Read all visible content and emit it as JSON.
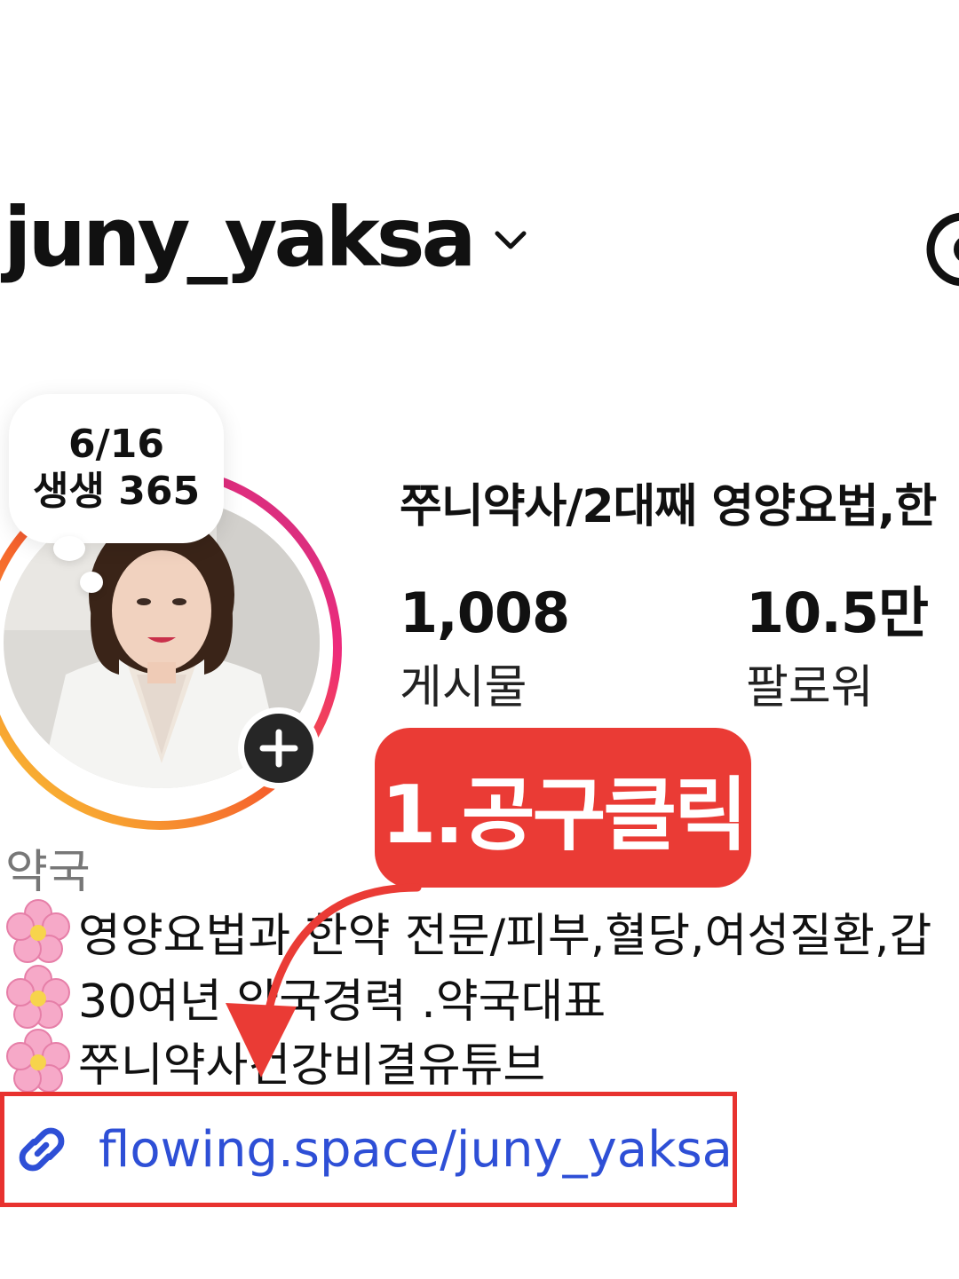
{
  "header": {
    "username": "juny_yaksa",
    "accent": "#111111"
  },
  "story": {
    "bubble_line1": "6/16",
    "bubble_line2": "생생 365",
    "ring_colors": [
      "#f9ce34",
      "#ee2a7b",
      "#c13584"
    ]
  },
  "profile": {
    "display_name": "쭈니약사/2대째 영양요법,한",
    "stats": [
      {
        "value": "1,008",
        "label": "게시물"
      },
      {
        "value": "10.5만",
        "label": "팔로워"
      }
    ],
    "category": "약국",
    "bio": [
      "영양요법과 한약 전문/피부,혈당,여성질환,갑",
      "30여년 약국경력 .약국대표",
      "쭈니약사건강비결유튜브"
    ],
    "link": "flowing.space/juny_yaksa",
    "link_color": "#2e4fd6"
  },
  "annotation": {
    "callout": "1.공구클릭",
    "color": "#ea3b35"
  }
}
